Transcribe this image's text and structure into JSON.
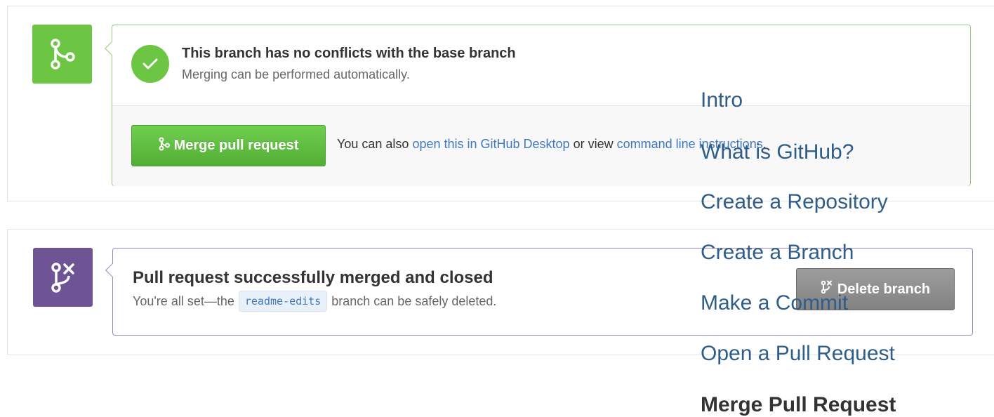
{
  "colors": {
    "open_green": "#6cc644",
    "merged_purple": "#6e5494",
    "link_blue": "#4078c0",
    "nav_blue": "#2f5d8a",
    "delete_gray": "#8e8e8e"
  },
  "merge_panel": {
    "state_icon": "git-merge-icon",
    "status_icon": "check-icon",
    "title": "This branch has no conflicts with the base branch",
    "subtitle": "Merging can be performed automatically.",
    "button_label": "Merge pull request",
    "button_icon": "git-merge-icon",
    "footer_prefix": "You can also",
    "desktop_link": "open this in GitHub Desktop",
    "footer_middle": "or view",
    "cli_link": "command line instructions",
    "footer_suffix": "."
  },
  "merged_panel": {
    "state_icon": "git-branch-delete-icon",
    "title": "Pull request successfully merged and closed",
    "subtitle_prefix": "You're all set—the",
    "branch": "readme-edits",
    "subtitle_suffix": "branch can be safely deleted.",
    "delete_label": "Delete branch",
    "delete_icon": "git-branch-delete-icon"
  },
  "guide_nav": {
    "items": [
      {
        "label": "Intro",
        "current": false
      },
      {
        "label": "What is GitHub?",
        "current": false
      },
      {
        "label": "Create a Repository",
        "current": false
      },
      {
        "label": "Create a Branch",
        "current": false
      },
      {
        "label": "Make a Commit",
        "current": false
      },
      {
        "label": "Open a Pull Request",
        "current": false
      },
      {
        "label": "Merge Pull Request",
        "current": true
      }
    ]
  }
}
